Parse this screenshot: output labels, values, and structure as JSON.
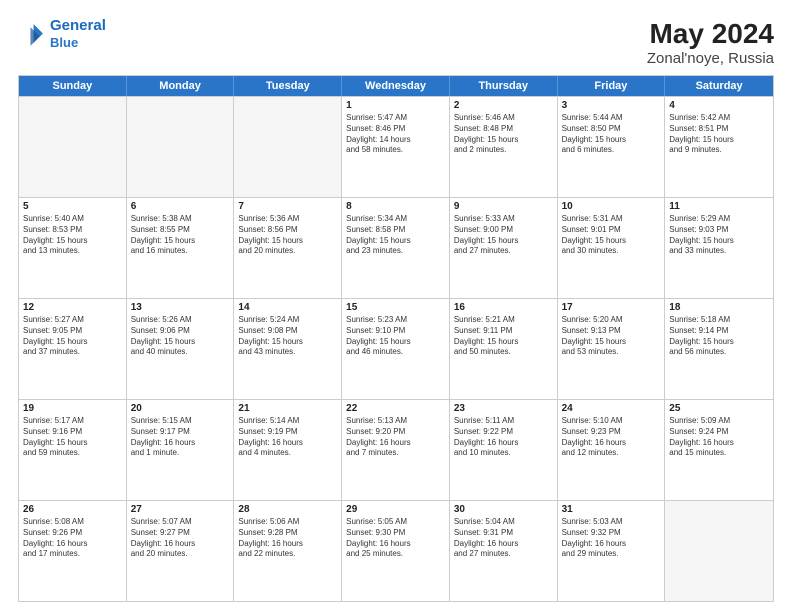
{
  "header": {
    "logo_line1": "General",
    "logo_line2": "Blue",
    "title": "May 2024",
    "subtitle": "Zonal'noye, Russia"
  },
  "days_of_week": [
    "Sunday",
    "Monday",
    "Tuesday",
    "Wednesday",
    "Thursday",
    "Friday",
    "Saturday"
  ],
  "rows": [
    [
      {
        "day": "",
        "text": "",
        "empty": true
      },
      {
        "day": "",
        "text": "",
        "empty": true
      },
      {
        "day": "",
        "text": "",
        "empty": true
      },
      {
        "day": "1",
        "text": "Sunrise: 5:47 AM\nSunset: 8:46 PM\nDaylight: 14 hours\nand 58 minutes."
      },
      {
        "day": "2",
        "text": "Sunrise: 5:46 AM\nSunset: 8:48 PM\nDaylight: 15 hours\nand 2 minutes."
      },
      {
        "day": "3",
        "text": "Sunrise: 5:44 AM\nSunset: 8:50 PM\nDaylight: 15 hours\nand 6 minutes."
      },
      {
        "day": "4",
        "text": "Sunrise: 5:42 AM\nSunset: 8:51 PM\nDaylight: 15 hours\nand 9 minutes."
      }
    ],
    [
      {
        "day": "5",
        "text": "Sunrise: 5:40 AM\nSunset: 8:53 PM\nDaylight: 15 hours\nand 13 minutes."
      },
      {
        "day": "6",
        "text": "Sunrise: 5:38 AM\nSunset: 8:55 PM\nDaylight: 15 hours\nand 16 minutes."
      },
      {
        "day": "7",
        "text": "Sunrise: 5:36 AM\nSunset: 8:56 PM\nDaylight: 15 hours\nand 20 minutes."
      },
      {
        "day": "8",
        "text": "Sunrise: 5:34 AM\nSunset: 8:58 PM\nDaylight: 15 hours\nand 23 minutes."
      },
      {
        "day": "9",
        "text": "Sunrise: 5:33 AM\nSunset: 9:00 PM\nDaylight: 15 hours\nand 27 minutes."
      },
      {
        "day": "10",
        "text": "Sunrise: 5:31 AM\nSunset: 9:01 PM\nDaylight: 15 hours\nand 30 minutes."
      },
      {
        "day": "11",
        "text": "Sunrise: 5:29 AM\nSunset: 9:03 PM\nDaylight: 15 hours\nand 33 minutes."
      }
    ],
    [
      {
        "day": "12",
        "text": "Sunrise: 5:27 AM\nSunset: 9:05 PM\nDaylight: 15 hours\nand 37 minutes."
      },
      {
        "day": "13",
        "text": "Sunrise: 5:26 AM\nSunset: 9:06 PM\nDaylight: 15 hours\nand 40 minutes."
      },
      {
        "day": "14",
        "text": "Sunrise: 5:24 AM\nSunset: 9:08 PM\nDaylight: 15 hours\nand 43 minutes."
      },
      {
        "day": "15",
        "text": "Sunrise: 5:23 AM\nSunset: 9:10 PM\nDaylight: 15 hours\nand 46 minutes."
      },
      {
        "day": "16",
        "text": "Sunrise: 5:21 AM\nSunset: 9:11 PM\nDaylight: 15 hours\nand 50 minutes."
      },
      {
        "day": "17",
        "text": "Sunrise: 5:20 AM\nSunset: 9:13 PM\nDaylight: 15 hours\nand 53 minutes."
      },
      {
        "day": "18",
        "text": "Sunrise: 5:18 AM\nSunset: 9:14 PM\nDaylight: 15 hours\nand 56 minutes."
      }
    ],
    [
      {
        "day": "19",
        "text": "Sunrise: 5:17 AM\nSunset: 9:16 PM\nDaylight: 15 hours\nand 59 minutes."
      },
      {
        "day": "20",
        "text": "Sunrise: 5:15 AM\nSunset: 9:17 PM\nDaylight: 16 hours\nand 1 minute."
      },
      {
        "day": "21",
        "text": "Sunrise: 5:14 AM\nSunset: 9:19 PM\nDaylight: 16 hours\nand 4 minutes."
      },
      {
        "day": "22",
        "text": "Sunrise: 5:13 AM\nSunset: 9:20 PM\nDaylight: 16 hours\nand 7 minutes."
      },
      {
        "day": "23",
        "text": "Sunrise: 5:11 AM\nSunset: 9:22 PM\nDaylight: 16 hours\nand 10 minutes."
      },
      {
        "day": "24",
        "text": "Sunrise: 5:10 AM\nSunset: 9:23 PM\nDaylight: 16 hours\nand 12 minutes."
      },
      {
        "day": "25",
        "text": "Sunrise: 5:09 AM\nSunset: 9:24 PM\nDaylight: 16 hours\nand 15 minutes."
      }
    ],
    [
      {
        "day": "26",
        "text": "Sunrise: 5:08 AM\nSunset: 9:26 PM\nDaylight: 16 hours\nand 17 minutes."
      },
      {
        "day": "27",
        "text": "Sunrise: 5:07 AM\nSunset: 9:27 PM\nDaylight: 16 hours\nand 20 minutes."
      },
      {
        "day": "28",
        "text": "Sunrise: 5:06 AM\nSunset: 9:28 PM\nDaylight: 16 hours\nand 22 minutes."
      },
      {
        "day": "29",
        "text": "Sunrise: 5:05 AM\nSunset: 9:30 PM\nDaylight: 16 hours\nand 25 minutes."
      },
      {
        "day": "30",
        "text": "Sunrise: 5:04 AM\nSunset: 9:31 PM\nDaylight: 16 hours\nand 27 minutes."
      },
      {
        "day": "31",
        "text": "Sunrise: 5:03 AM\nSunset: 9:32 PM\nDaylight: 16 hours\nand 29 minutes."
      },
      {
        "day": "",
        "text": "",
        "empty": true
      }
    ]
  ]
}
